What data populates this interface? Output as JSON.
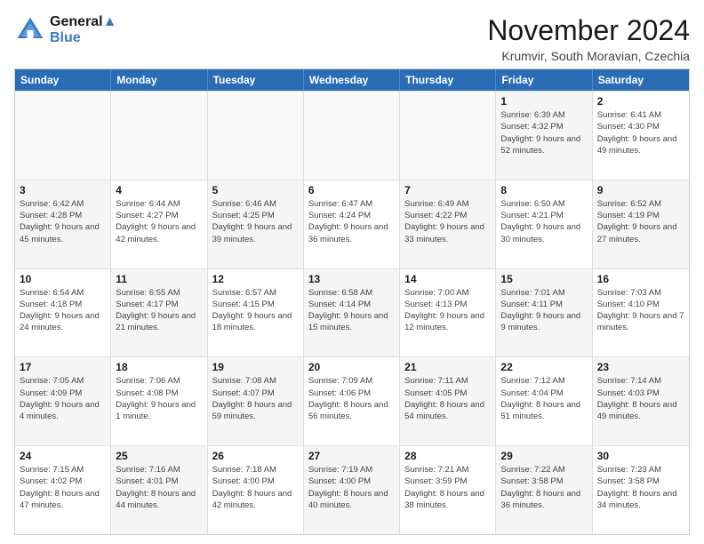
{
  "header": {
    "logo_line1": "General",
    "logo_line2": "Blue",
    "month_title": "November 2024",
    "location": "Krumvir, South Moravian, Czechia"
  },
  "calendar": {
    "days_of_week": [
      "Sunday",
      "Monday",
      "Tuesday",
      "Wednesday",
      "Thursday",
      "Friday",
      "Saturday"
    ],
    "weeks": [
      [
        {
          "day": "",
          "empty": true
        },
        {
          "day": "",
          "empty": true
        },
        {
          "day": "",
          "empty": true
        },
        {
          "day": "",
          "empty": true
        },
        {
          "day": "",
          "empty": true
        },
        {
          "day": "1",
          "sunrise": "Sunrise: 6:39 AM",
          "sunset": "Sunset: 4:32 PM",
          "daylight": "Daylight: 9 hours and 52 minutes.",
          "shaded": true
        },
        {
          "day": "2",
          "sunrise": "Sunrise: 6:41 AM",
          "sunset": "Sunset: 4:30 PM",
          "daylight": "Daylight: 9 hours and 49 minutes.",
          "shaded": false
        }
      ],
      [
        {
          "day": "3",
          "sunrise": "Sunrise: 6:42 AM",
          "sunset": "Sunset: 4:28 PM",
          "daylight": "Daylight: 9 hours and 45 minutes.",
          "shaded": true
        },
        {
          "day": "4",
          "sunrise": "Sunrise: 6:44 AM",
          "sunset": "Sunset: 4:27 PM",
          "daylight": "Daylight: 9 hours and 42 minutes.",
          "shaded": false
        },
        {
          "day": "5",
          "sunrise": "Sunrise: 6:46 AM",
          "sunset": "Sunset: 4:25 PM",
          "daylight": "Daylight: 9 hours and 39 minutes.",
          "shaded": true
        },
        {
          "day": "6",
          "sunrise": "Sunrise: 6:47 AM",
          "sunset": "Sunset: 4:24 PM",
          "daylight": "Daylight: 9 hours and 36 minutes.",
          "shaded": false
        },
        {
          "day": "7",
          "sunrise": "Sunrise: 6:49 AM",
          "sunset": "Sunset: 4:22 PM",
          "daylight": "Daylight: 9 hours and 33 minutes.",
          "shaded": true
        },
        {
          "day": "8",
          "sunrise": "Sunrise: 6:50 AM",
          "sunset": "Sunset: 4:21 PM",
          "daylight": "Daylight: 9 hours and 30 minutes.",
          "shaded": false
        },
        {
          "day": "9",
          "sunrise": "Sunrise: 6:52 AM",
          "sunset": "Sunset: 4:19 PM",
          "daylight": "Daylight: 9 hours and 27 minutes.",
          "shaded": true
        }
      ],
      [
        {
          "day": "10",
          "sunrise": "Sunrise: 6:54 AM",
          "sunset": "Sunset: 4:18 PM",
          "daylight": "Daylight: 9 hours and 24 minutes.",
          "shaded": false
        },
        {
          "day": "11",
          "sunrise": "Sunrise: 6:55 AM",
          "sunset": "Sunset: 4:17 PM",
          "daylight": "Daylight: 9 hours and 21 minutes.",
          "shaded": true
        },
        {
          "day": "12",
          "sunrise": "Sunrise: 6:57 AM",
          "sunset": "Sunset: 4:15 PM",
          "daylight": "Daylight: 9 hours and 18 minutes.",
          "shaded": false
        },
        {
          "day": "13",
          "sunrise": "Sunrise: 6:58 AM",
          "sunset": "Sunset: 4:14 PM",
          "daylight": "Daylight: 9 hours and 15 minutes.",
          "shaded": true
        },
        {
          "day": "14",
          "sunrise": "Sunrise: 7:00 AM",
          "sunset": "Sunset: 4:13 PM",
          "daylight": "Daylight: 9 hours and 12 minutes.",
          "shaded": false
        },
        {
          "day": "15",
          "sunrise": "Sunrise: 7:01 AM",
          "sunset": "Sunset: 4:11 PM",
          "daylight": "Daylight: 9 hours and 9 minutes.",
          "shaded": true
        },
        {
          "day": "16",
          "sunrise": "Sunrise: 7:03 AM",
          "sunset": "Sunset: 4:10 PM",
          "daylight": "Daylight: 9 hours and 7 minutes.",
          "shaded": false
        }
      ],
      [
        {
          "day": "17",
          "sunrise": "Sunrise: 7:05 AM",
          "sunset": "Sunset: 4:09 PM",
          "daylight": "Daylight: 9 hours and 4 minutes.",
          "shaded": true
        },
        {
          "day": "18",
          "sunrise": "Sunrise: 7:06 AM",
          "sunset": "Sunset: 4:08 PM",
          "daylight": "Daylight: 9 hours and 1 minute.",
          "shaded": false
        },
        {
          "day": "19",
          "sunrise": "Sunrise: 7:08 AM",
          "sunset": "Sunset: 4:07 PM",
          "daylight": "Daylight: 8 hours and 59 minutes.",
          "shaded": true
        },
        {
          "day": "20",
          "sunrise": "Sunrise: 7:09 AM",
          "sunset": "Sunset: 4:06 PM",
          "daylight": "Daylight: 8 hours and 56 minutes.",
          "shaded": false
        },
        {
          "day": "21",
          "sunrise": "Sunrise: 7:11 AM",
          "sunset": "Sunset: 4:05 PM",
          "daylight": "Daylight: 8 hours and 54 minutes.",
          "shaded": true
        },
        {
          "day": "22",
          "sunrise": "Sunrise: 7:12 AM",
          "sunset": "Sunset: 4:04 PM",
          "daylight": "Daylight: 8 hours and 51 minutes.",
          "shaded": false
        },
        {
          "day": "23",
          "sunrise": "Sunrise: 7:14 AM",
          "sunset": "Sunset: 4:03 PM",
          "daylight": "Daylight: 8 hours and 49 minutes.",
          "shaded": true
        }
      ],
      [
        {
          "day": "24",
          "sunrise": "Sunrise: 7:15 AM",
          "sunset": "Sunset: 4:02 PM",
          "daylight": "Daylight: 8 hours and 47 minutes.",
          "shaded": false
        },
        {
          "day": "25",
          "sunrise": "Sunrise: 7:16 AM",
          "sunset": "Sunset: 4:01 PM",
          "daylight": "Daylight: 8 hours and 44 minutes.",
          "shaded": true
        },
        {
          "day": "26",
          "sunrise": "Sunrise: 7:18 AM",
          "sunset": "Sunset: 4:00 PM",
          "daylight": "Daylight: 8 hours and 42 minutes.",
          "shaded": false
        },
        {
          "day": "27",
          "sunrise": "Sunrise: 7:19 AM",
          "sunset": "Sunset: 4:00 PM",
          "daylight": "Daylight: 8 hours and 40 minutes.",
          "shaded": true
        },
        {
          "day": "28",
          "sunrise": "Sunrise: 7:21 AM",
          "sunset": "Sunset: 3:59 PM",
          "daylight": "Daylight: 8 hours and 38 minutes.",
          "shaded": false
        },
        {
          "day": "29",
          "sunrise": "Sunrise: 7:22 AM",
          "sunset": "Sunset: 3:58 PM",
          "daylight": "Daylight: 8 hours and 36 minutes.",
          "shaded": true
        },
        {
          "day": "30",
          "sunrise": "Sunrise: 7:23 AM",
          "sunset": "Sunset: 3:58 PM",
          "daylight": "Daylight: 8 hours and 34 minutes.",
          "shaded": false
        }
      ]
    ]
  }
}
